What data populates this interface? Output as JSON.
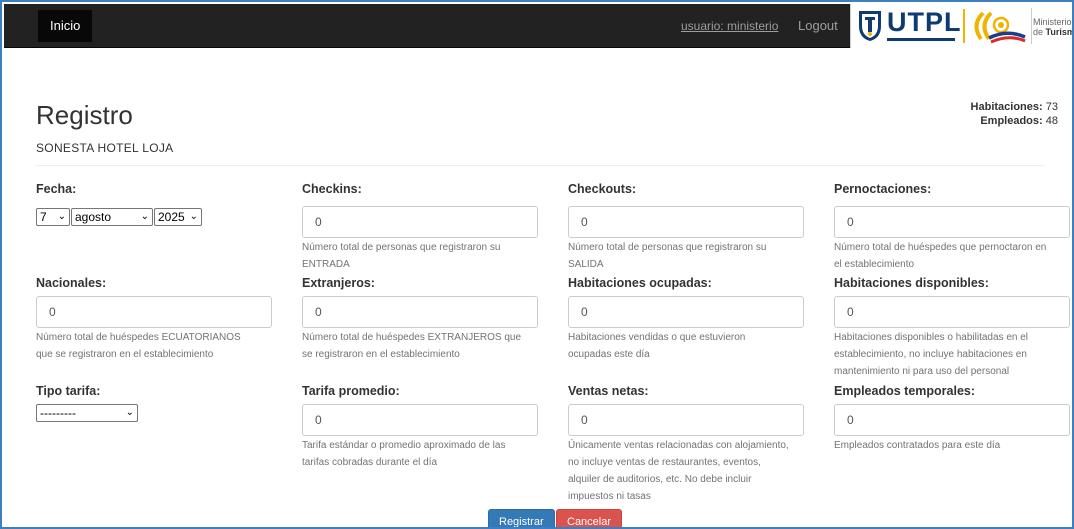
{
  "nav": {
    "home_label": "Inicio",
    "user_label": "usuario: ministerio",
    "logout_label": "Logout",
    "utpl_logo_text": "UTPL",
    "mintur_line1": "Ministerio",
    "mintur_line2_prefix": "de ",
    "mintur_line2_bold": "Turismo"
  },
  "header": {
    "title": "Registro",
    "hotel": "SONESTA HOTEL LOJA",
    "habitaciones_label": "Habitaciones:",
    "habitaciones_value": "73",
    "empleados_label": "Empleados:",
    "empleados_value": "48"
  },
  "form": {
    "fecha": {
      "label": "Fecha:",
      "day": "7",
      "month": "agosto",
      "year": "2025"
    },
    "checkins": {
      "label": "Checkins:",
      "value": "0",
      "help1": "Número total de personas que registraron su",
      "help2": "ENTRADA"
    },
    "checkouts": {
      "label": "Checkouts:",
      "value": "0",
      "help1": "Número total de personas que registraron su",
      "help2": "SALIDA"
    },
    "pernoctaciones": {
      "label": "Pernoctaciones:",
      "value": "0",
      "help1": "Número total de huéspedes que pernoctaron en",
      "help2": "el establecimiento"
    },
    "nacionales": {
      "label": "Nacionales:",
      "value": "0",
      "help1": "Número total de huéspedes ECUATORIANOS",
      "help2": "que se registraron en el establecimiento"
    },
    "extranjeros": {
      "label": "Extranjeros:",
      "value": "0",
      "help1": "Número total de huéspedes EXTRANJEROS que",
      "help2": "se registraron en el establecimiento"
    },
    "habitaciones_ocupadas": {
      "label": "Habitaciones ocupadas:",
      "value": "0",
      "help1": "Habitaciones vendidas o que estuvieron",
      "help2": "ocupadas este día"
    },
    "habitaciones_disponibles": {
      "label": "Habitaciones disponibles:",
      "value": "0",
      "help1": "Habitaciones disponibles o habilitadas en el",
      "help2": "establecimiento, no incluye habitaciones en",
      "help3": "mantenimiento ni para uso del personal"
    },
    "tipo_tarifa": {
      "label": "Tipo tarifa:",
      "value": "---------"
    },
    "tarifa_promedio": {
      "label": "Tarifa promedio:",
      "value": "0",
      "help1": "Tarifa estándar o promedio aproximado de las",
      "help2": "tarifas cobradas durante el día"
    },
    "ventas_netas": {
      "label": "Ventas netas:",
      "value": "0",
      "help1": "Únicamente ventas relacionadas con alojamiento,",
      "help2": "no incluye ventas de restaurantes, eventos,",
      "help3": "alquiler de auditorios, etc. No debe incluir",
      "help4": "impuestos ni tasas"
    },
    "empleados_temporales": {
      "label": "Empleados temporales:",
      "value": "0",
      "help1": "Empleados contratados para este día"
    }
  },
  "buttons": {
    "submit_label": "Registrar",
    "cancel_label": "Cancelar"
  },
  "colors": {
    "navbar": "#222222",
    "primary": "#337ab7",
    "danger": "#d9534f",
    "frame": "#3e7fc1"
  },
  "icons": {
    "select_arrow": "chevron-down-icon"
  }
}
